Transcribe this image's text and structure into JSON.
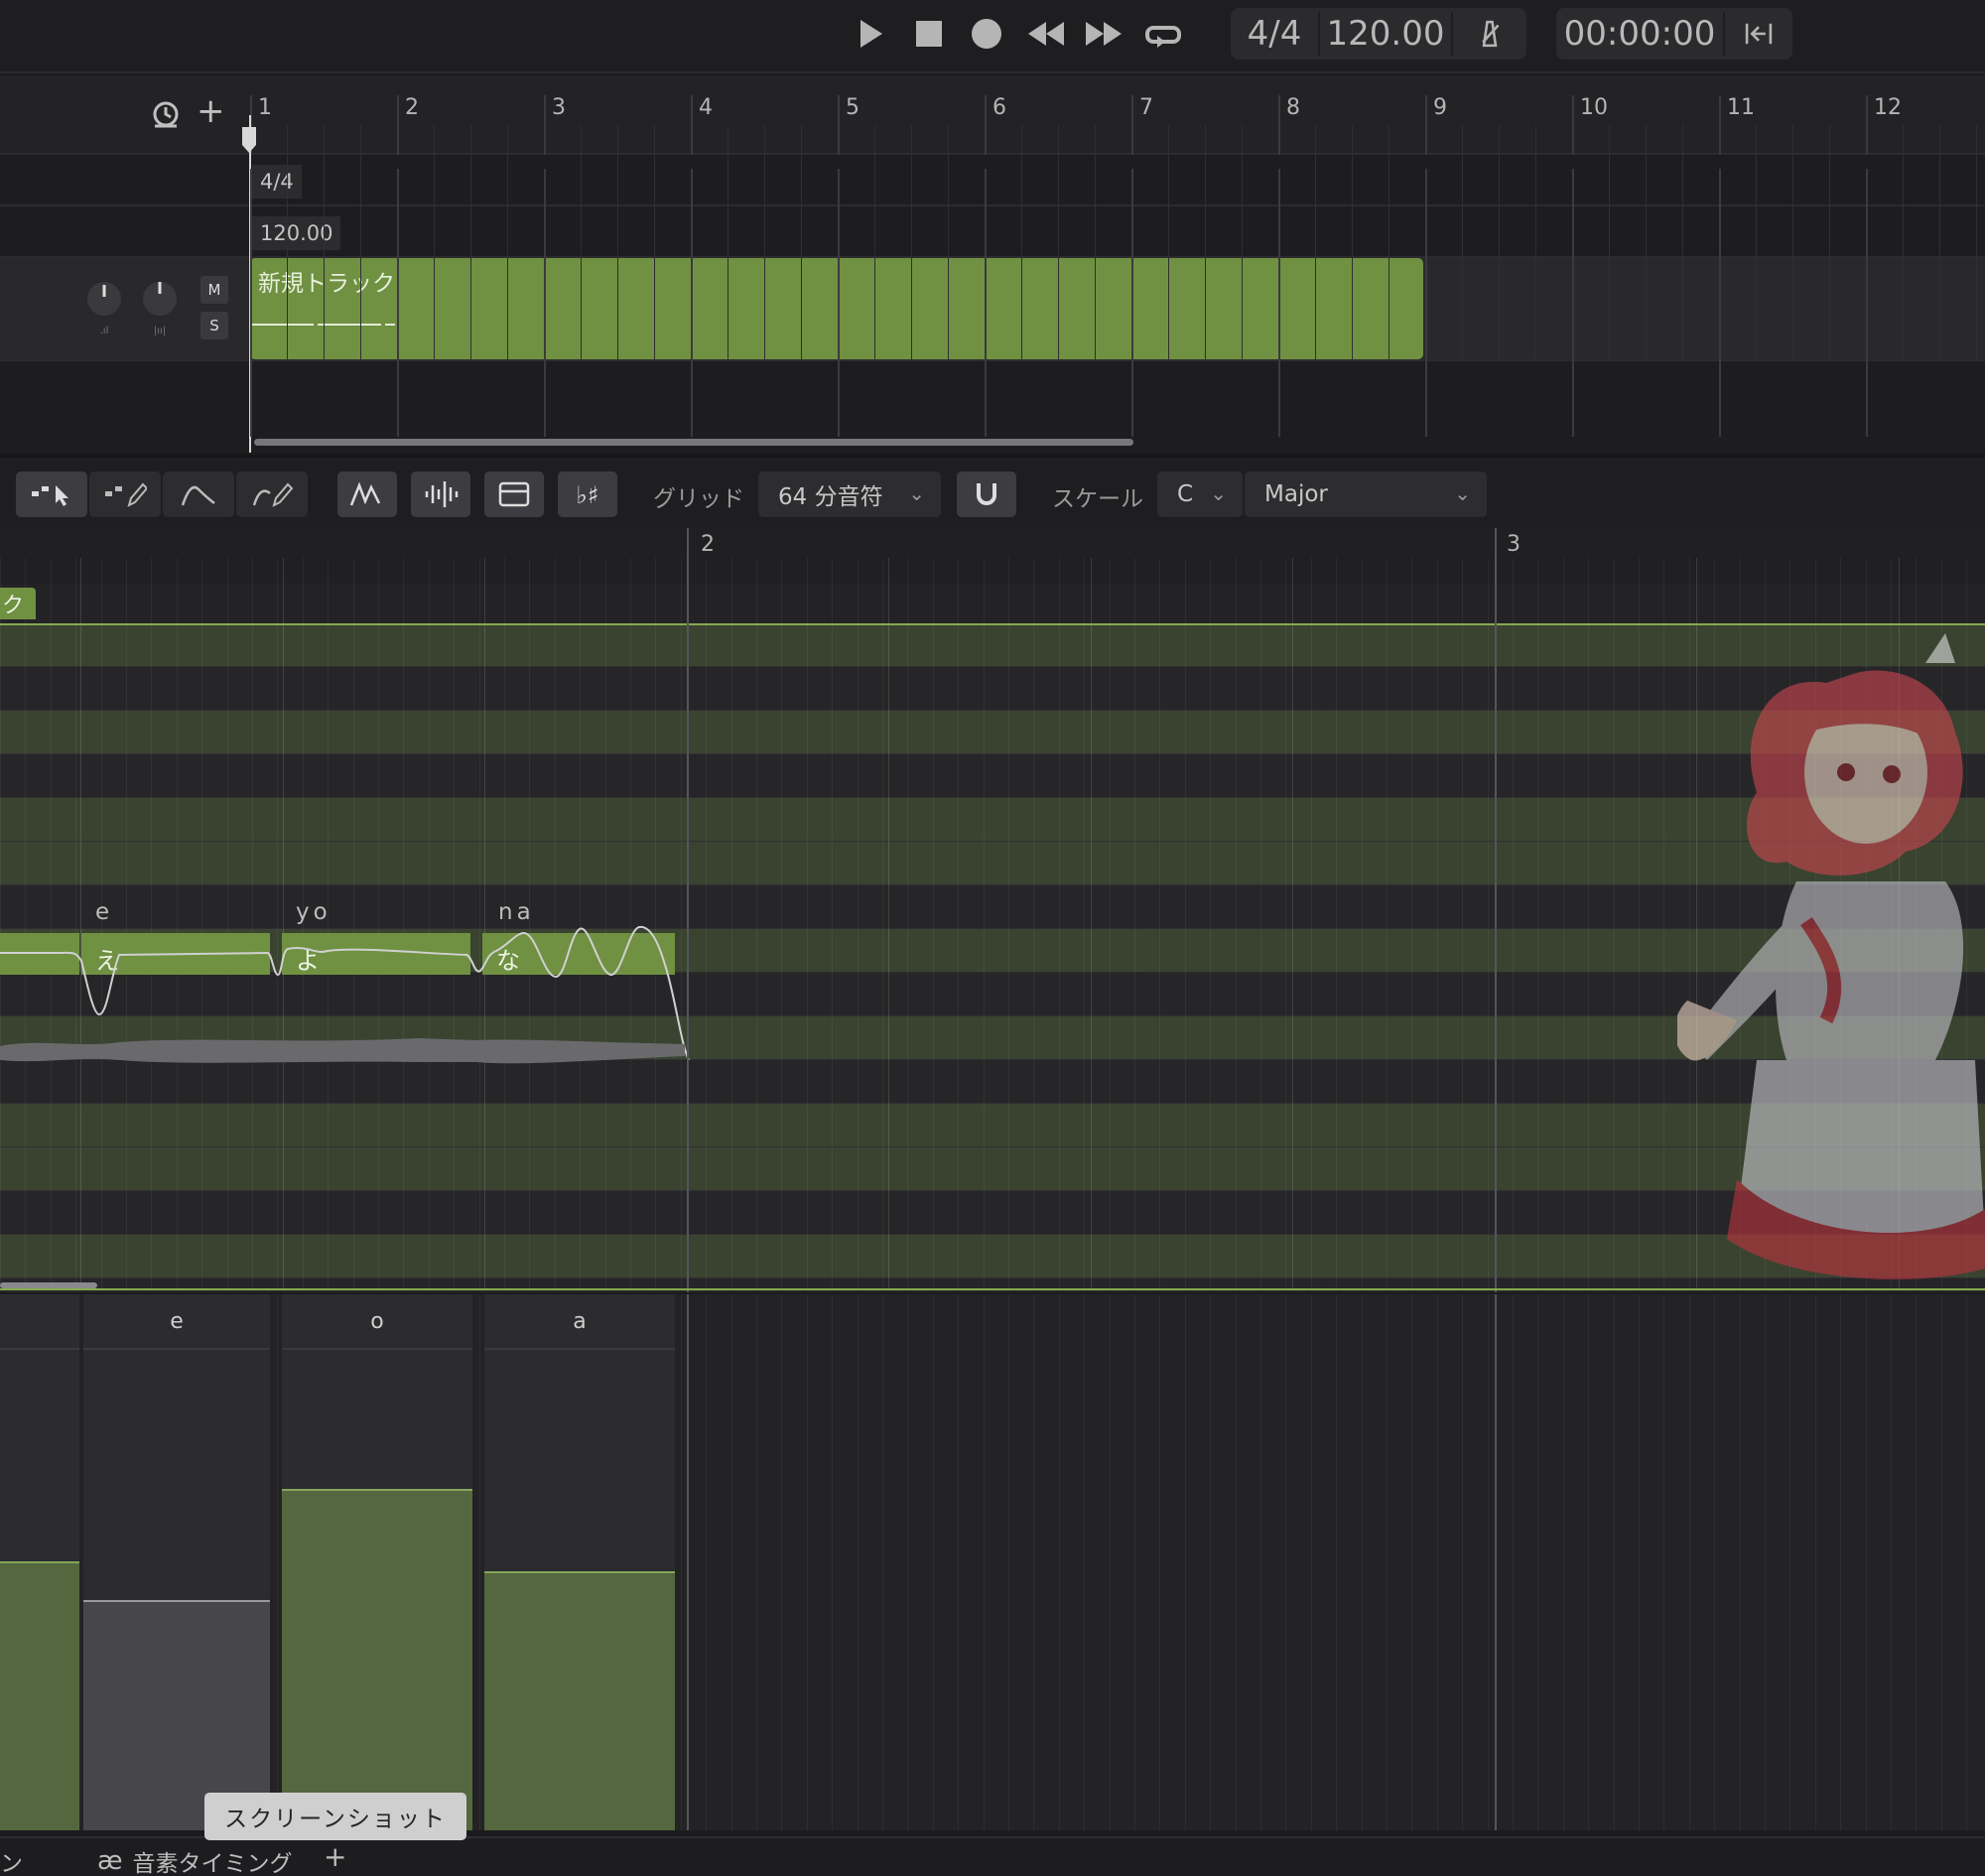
{
  "transport": {
    "time_signature": "4/4",
    "tempo": "120.00",
    "time": "00:00:00",
    "icons": [
      "play-icon",
      "stop-icon",
      "record-icon",
      "rewind-icon",
      "fast-forward-icon",
      "loop-icon",
      "metronome-icon",
      "go-to-start-icon"
    ]
  },
  "arrangement": {
    "bars": [
      "1",
      "2",
      "3",
      "4",
      "5",
      "6",
      "7",
      "8",
      "9",
      "10",
      "11",
      "12"
    ],
    "time_signature_marker": "4/4",
    "tempo_marker": "120.00",
    "track": {
      "mute_label": "M",
      "solo_label": "S"
    },
    "clip_title": "新規トラック"
  },
  "toolbar": {
    "grid_label": "グリッド",
    "grid_value": "64 分音符",
    "scale_label": "スケール",
    "scale_key": "C",
    "scale_mode": "Major"
  },
  "piano_roll": {
    "bars": [
      "2",
      "3"
    ],
    "clip_tab": "ク",
    "notes": [
      {
        "kana": "",
        "phoneme": ""
      },
      {
        "kana": "え",
        "phoneme": "e"
      },
      {
        "kana": "よ",
        "phoneme": "yo"
      },
      {
        "kana": "な",
        "phoneme": "na"
      }
    ]
  },
  "param_lane": {
    "columns": [
      {
        "label": "",
        "level": 0.56
      },
      {
        "label": "e",
        "level": 0.48
      },
      {
        "label": "o",
        "level": 0.71
      },
      {
        "label": "a",
        "level": 0.54
      }
    ]
  },
  "bottom": {
    "tooltip": "スクリーンショット",
    "left_tab_fragment": "ン",
    "tab_label": "音素タイミング",
    "tab_icon": "ae-ligature-icon",
    "add_tab": "+"
  },
  "colors": {
    "accent_green": "#6f9141",
    "background": "#1b1b1e"
  }
}
